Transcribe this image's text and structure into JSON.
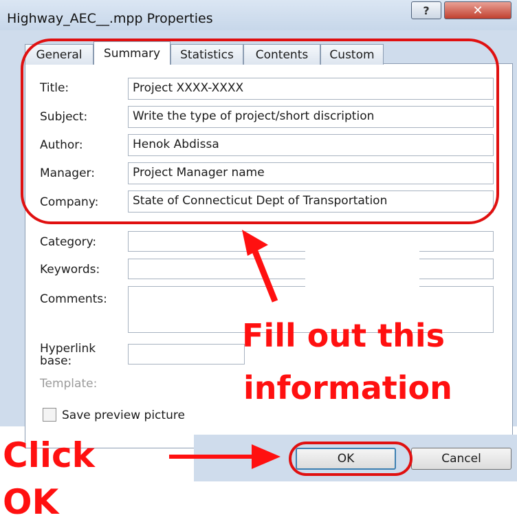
{
  "window": {
    "title": "Highway_AEC__.mpp Properties",
    "help_glyph": "?",
    "close_glyph": "✕"
  },
  "tabs": [
    "General",
    "Summary",
    "Statistics",
    "Contents",
    "Custom"
  ],
  "active_tab": "Summary",
  "fields": {
    "title": {
      "label": "Title:",
      "value": "Project XXXX-XXXX"
    },
    "subject": {
      "label": "Subject:",
      "value": "Write the type of project/short discription"
    },
    "author": {
      "label": "Author:",
      "value": "Henok Abdissa"
    },
    "manager": {
      "label": "Manager:",
      "value": "Project Manager name"
    },
    "company": {
      "label": "Company:",
      "value": "State of Connecticut Dept of Transportation"
    },
    "category": {
      "label": "Category:",
      "value": ""
    },
    "keywords": {
      "label": "Keywords:",
      "value": ""
    },
    "comments": {
      "label": "Comments:",
      "value": ""
    },
    "hyperlink_base": {
      "label_line1": "Hyperlink",
      "label_line2": "base:",
      "value": ""
    },
    "template": {
      "label": "Template:"
    }
  },
  "save_preview": {
    "label": "Save preview picture",
    "checked": false
  },
  "buttons": {
    "ok": "OK",
    "cancel": "Cancel"
  },
  "annotations": {
    "fill_line1": "Fill out this",
    "fill_line2": "information",
    "click_line1": "Click",
    "click_line2": "OK",
    "color": "#ff1010"
  }
}
